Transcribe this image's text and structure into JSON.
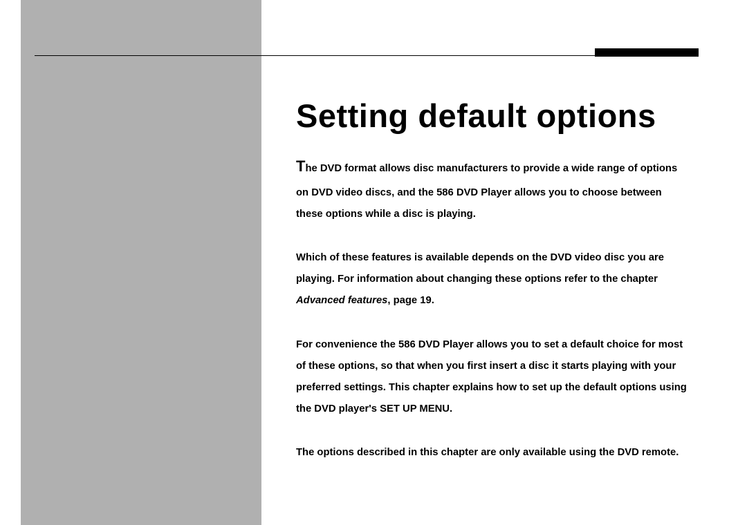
{
  "heading": "Setting default options",
  "p1_dropcap": "T",
  "p1_rest": "he DVD format allows disc manufacturers to provide a wide range of options on DVD video discs, and the 586 DVD Player allows you to choose between these options while a disc is playing.",
  "p2_a": "Which of these features is available depends on the DVD video disc you are playing. For information about changing these options refer to the chapter ",
  "p2_em": "Advanced features",
  "p2_b": ", page 19.",
  "p3": "For convenience the 586 DVD Player allows you to set a default choice for most of these options, so that when you first insert a disc it starts playing with your preferred settings. This chapter explains how to set up the default options using the DVD player's SET UP MENU.",
  "p4": "The options described in this chapter are only available using the DVD remote."
}
